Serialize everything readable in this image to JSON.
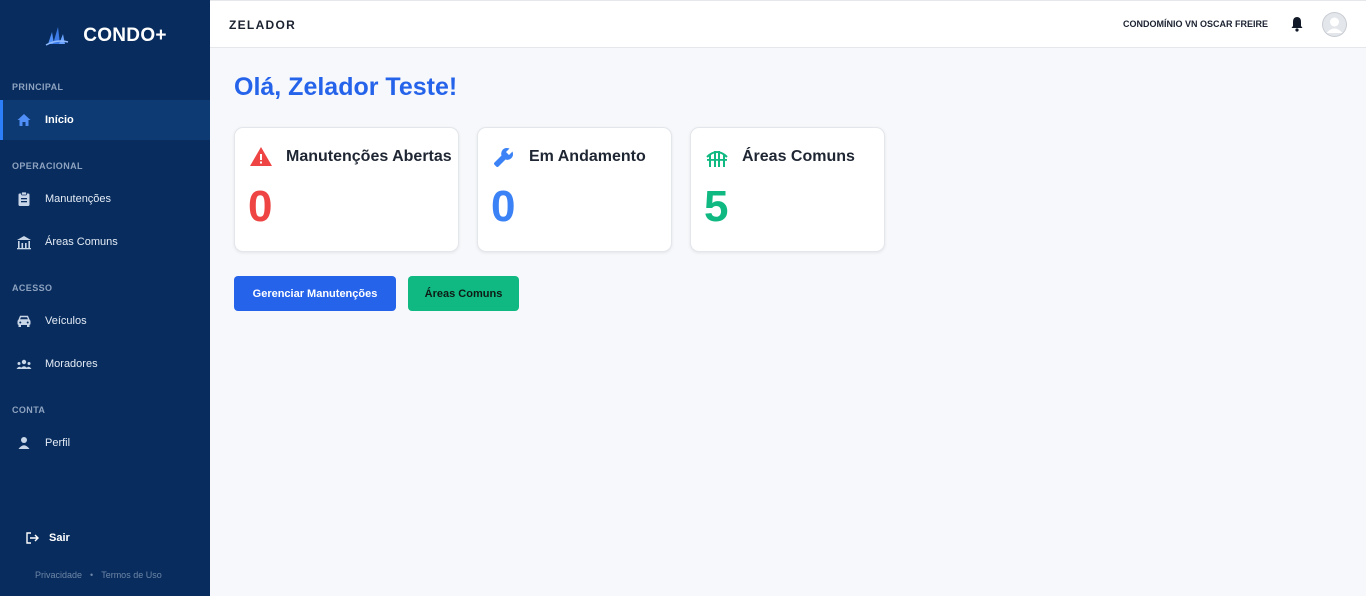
{
  "sidebar": {
    "brand": "CONDO+",
    "sections": {
      "principal": "PRINCIPAL",
      "operacional": "OPERACIONAL",
      "acesso": "ACESSO",
      "conta": "CONTA"
    },
    "items": [
      {
        "label": "Início",
        "icon": "home-icon",
        "active": true
      },
      {
        "label": "Manutenções",
        "icon": "clipboard-icon"
      },
      {
        "label": "Áreas Comuns",
        "icon": "building-icon"
      },
      {
        "label": "Veículos",
        "icon": "car-icon"
      },
      {
        "label": "Moradores",
        "icon": "users-icon"
      },
      {
        "label": "Perfil",
        "icon": "user-icon"
      }
    ],
    "logout": "Sair",
    "footer": {
      "privacy": "Privacidade",
      "separator": "•",
      "terms": "Termos de Uso"
    }
  },
  "topbar": {
    "title": "ZELADOR",
    "condo": "CONDOMÍNIO VN OSCAR FREIRE"
  },
  "main": {
    "greeting": "Olá, Zelador Teste!",
    "cards": [
      {
        "title": "Manutenções Abertas",
        "value": "0",
        "icon": "warning-icon",
        "color": "#ef4444"
      },
      {
        "title": "Em Andamento",
        "value": "0",
        "icon": "wrench-icon",
        "color": "#3b82f6"
      },
      {
        "title": "Áreas Comuns",
        "value": "5",
        "icon": "gate-icon",
        "color": "#10b981"
      }
    ],
    "buttons": {
      "manage": "Gerenciar Manutenções",
      "areas": "Áreas Comuns"
    }
  },
  "colors": {
    "sidebar_bg": "#072c5d",
    "primary": "#2563eb",
    "success": "#10b981",
    "danger": "#ef4444"
  }
}
